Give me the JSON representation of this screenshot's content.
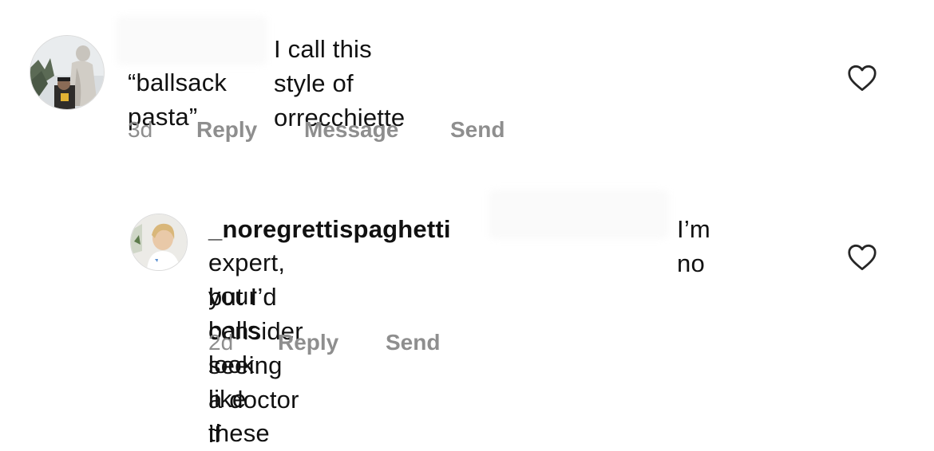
{
  "comments": [
    {
      "avatar": "avatar-statue-photo",
      "username": "",
      "line1": "I call this style of orrecchiette",
      "line2": "“ballsack pasta”",
      "time": "3d",
      "actions": [
        "Reply",
        "Message",
        "Send"
      ],
      "like_icon": "heart-outline-icon"
    },
    {
      "avatar": "avatar-woman-photo",
      "username": "_noregrettispaghetti",
      "line1_after": "I’m no",
      "line2": "expert, but I’d consider seeing a doctor if",
      "line3": "your balls look like these",
      "time": "2d",
      "actions": [
        "Reply",
        "Send"
      ],
      "like_icon": "heart-outline-icon"
    }
  ],
  "colors": {
    "text": "#111111",
    "meta": "#8e8e8e",
    "icon": "#262626"
  }
}
